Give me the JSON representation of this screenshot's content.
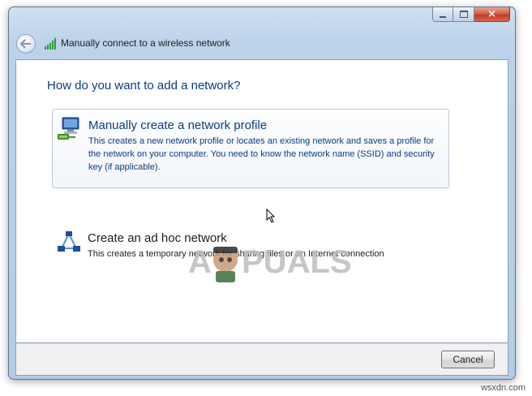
{
  "window": {
    "title": "Manually connect to a wireless network",
    "controls": {
      "minimize": "minimize",
      "maximize": "maximize",
      "close": "×"
    }
  },
  "content": {
    "heading": "How do you want to add a network?",
    "options": [
      {
        "title": "Manually create a network profile",
        "description": "This creates a new network profile or locates an existing network and saves a profile for the network on your computer. You need to know the network name (SSID) and security key (if applicable).",
        "icon": "network-computer-icon"
      },
      {
        "title": "Create an ad hoc network",
        "description": "This creates a temporary network for sharing files or an Internet connection",
        "icon": "adhoc-network-icon"
      }
    ]
  },
  "footer": {
    "cancel_label": "Cancel"
  },
  "watermark": {
    "text": "APPUALS"
  },
  "site_brand": "wsxdn.com",
  "colors": {
    "link_blue": "#0a3d82",
    "frame": "#b4cbe6",
    "close_red": "#c0392b"
  }
}
